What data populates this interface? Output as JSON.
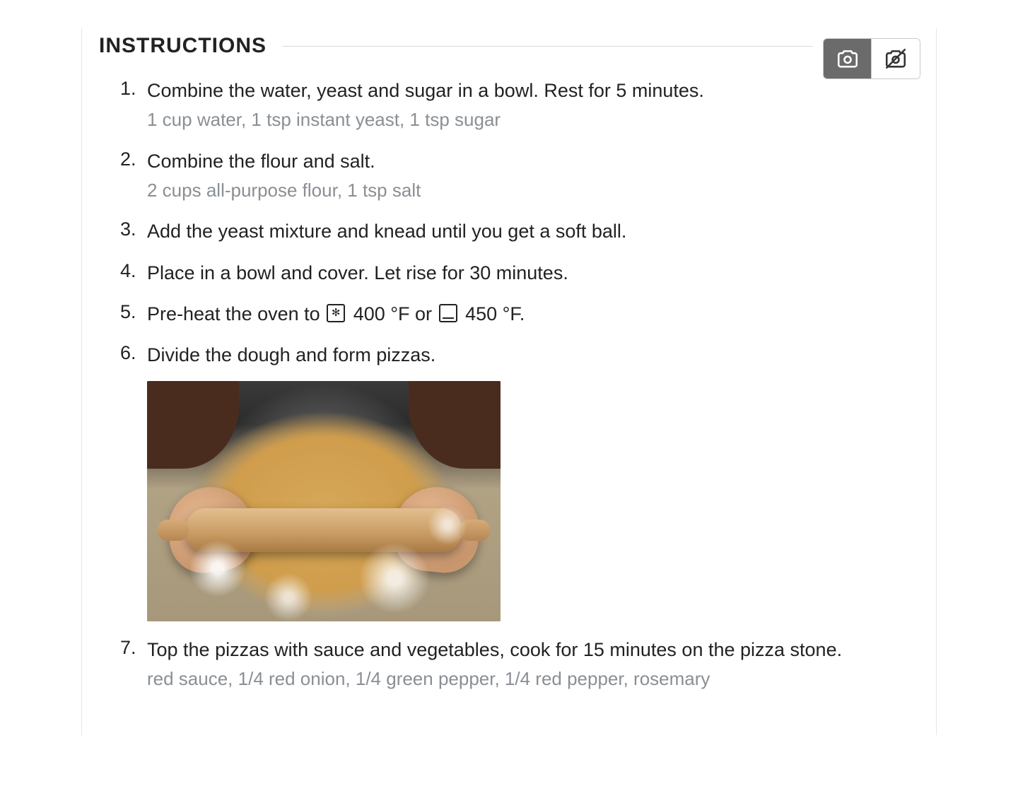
{
  "section": {
    "title": "INSTRUCTIONS"
  },
  "toggles": {
    "show_photos": {
      "active": true,
      "name": "show-photos-toggle"
    },
    "hide_photos": {
      "active": false,
      "name": "hide-photos-toggle"
    }
  },
  "steps": [
    {
      "text": "Combine the water, yeast and sugar in a bowl. Rest for 5 minutes.",
      "ingredients": "1 cup water, 1 tsp instant yeast, 1 tsp sugar"
    },
    {
      "text": "Combine the flour and salt.",
      "ingredients": "2 cups all-purpose flour, 1 tsp salt"
    },
    {
      "text": "Add the yeast mixture and knead until you get a soft ball."
    },
    {
      "text": "Place in a bowl and cover. Let rise for 30 minutes."
    },
    {
      "oven": {
        "prefix": "Pre-heat the oven to ",
        "fan_temp": "400 °F",
        "sep": " or ",
        "conv_temp": "450 °F",
        "suffix": "."
      }
    },
    {
      "text": "Divide the dough and form pizzas.",
      "image": {
        "alt": "Hands rolling pizza dough with a rolling pin on a floured surface"
      }
    },
    {
      "text": "Top the pizzas with sauce and vegetables, cook for 15 minutes on the pizza stone.",
      "ingredients": "red sauce, 1/4 red onion, 1/4 green pepper, 1/4 red pepper, rosemary"
    }
  ]
}
